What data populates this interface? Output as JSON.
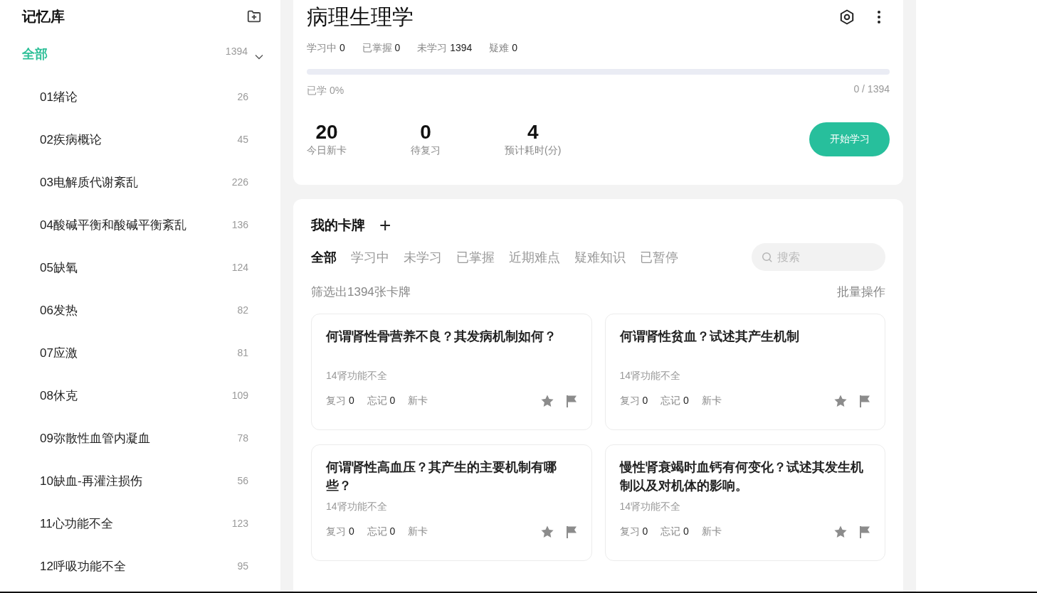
{
  "sidebar": {
    "title": "记忆库",
    "all": {
      "label": "全部",
      "count": "1394",
      "selected": true,
      "expanded": true
    },
    "items": [
      {
        "label": "01绪论",
        "count": "26",
        "selected": false
      },
      {
        "label": "02疾病概论",
        "count": "45",
        "selected": false
      },
      {
        "label": "03电解质代谢紊乱",
        "count": "226",
        "selected": false
      },
      {
        "label": "04酸碱平衡和酸碱平衡紊乱",
        "count": "136",
        "selected": false
      },
      {
        "label": "05缺氧",
        "count": "124",
        "selected": false
      },
      {
        "label": "06发热",
        "count": "82",
        "selected": false
      },
      {
        "label": "07应激",
        "count": "81",
        "selected": false
      },
      {
        "label": "08休克",
        "count": "109",
        "selected": false
      },
      {
        "label": "09弥散性血管内凝血",
        "count": "78",
        "selected": false
      },
      {
        "label": "10缺血-再灌注损伤",
        "count": "56",
        "selected": false
      },
      {
        "label": "11心功能不全",
        "count": "123",
        "selected": false
      },
      {
        "label": "12呼吸功能不全",
        "count": "95",
        "selected": false
      }
    ]
  },
  "deck": {
    "title": "病理生理学",
    "stats": [
      {
        "label": "学习中",
        "value": "0"
      },
      {
        "label": "已掌握",
        "value": "0"
      },
      {
        "label": "未学习",
        "value": "1394"
      },
      {
        "label": "疑难",
        "value": "0"
      }
    ],
    "progress": {
      "level": 0,
      "learned": "已学 0%",
      "ratio": "0 / 1394"
    },
    "metrics": [
      {
        "value": "20",
        "label": "今日新卡"
      },
      {
        "value": "0",
        "label": "待复习"
      },
      {
        "value": "4",
        "label": "预计耗时(分)"
      }
    ],
    "start_button": "开始学习"
  },
  "cards_panel": {
    "title": "我的卡牌",
    "add": "+",
    "tabs": [
      {
        "label": "全部",
        "selected": true
      },
      {
        "label": "学习中",
        "selected": false
      },
      {
        "label": "未学习",
        "selected": false
      },
      {
        "label": "已掌握",
        "selected": false
      },
      {
        "label": "近期难点",
        "selected": false
      },
      {
        "label": "疑难知识",
        "selected": false
      },
      {
        "label": "已暂停",
        "selected": false
      }
    ],
    "search": {
      "placeholder": "搜索"
    },
    "filter_text": "筛选出1394张卡牌",
    "batch": "批量操作",
    "cards": [
      {
        "question": "何谓肾性骨营养不良？其发病机制如何？",
        "topic": "14肾功能不全",
        "stats": [
          {
            "label": "复习",
            "value": "0"
          },
          {
            "label": "忘记",
            "value": "0"
          }
        ],
        "status": "新卡"
      },
      {
        "question": "何谓肾性贫血？试述其产生机制",
        "topic": "14肾功能不全",
        "stats": [
          {
            "label": "复习",
            "value": "0"
          },
          {
            "label": "忘记",
            "value": "0"
          }
        ],
        "status": "新卡"
      },
      {
        "question": "何谓肾性高血压？其产生的主要机制有哪些？",
        "topic": "14肾功能不全",
        "stats": [
          {
            "label": "复习",
            "value": "0"
          },
          {
            "label": "忘记",
            "value": "0"
          }
        ],
        "status": "新卡"
      },
      {
        "question": "慢性肾衰竭时血钙有何变化？试述其发生机制以及对机体的影响。",
        "topic": "14肾功能不全",
        "stats": [
          {
            "label": "复习",
            "value": "0"
          },
          {
            "label": "忘记",
            "value": "0"
          }
        ],
        "status": "新卡"
      }
    ]
  }
}
